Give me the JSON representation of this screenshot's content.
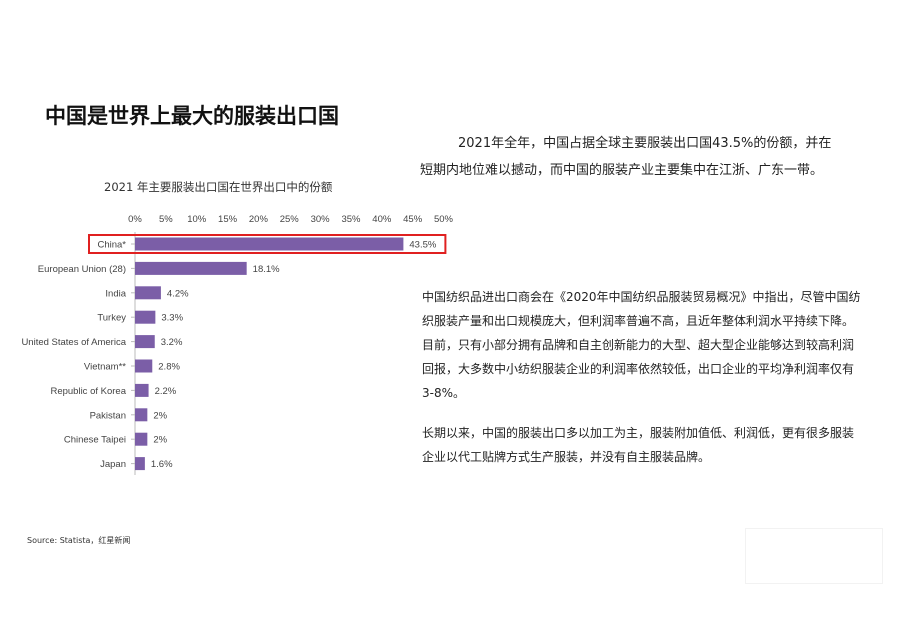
{
  "slide": {
    "title": "中国是世界上最大的服装出口国",
    "paragraph1": "2021年全年，中国占据全球主要服装出口国43.5%的份额，并在短期内地位难以撼动，而中国的服装产业主要集中在江浙、广东一带。",
    "paragraph2": "中国纺织品进出口商会在《2020年中国纺织品服装贸易概况》中指出，尽管中国纺织服装产量和出口规模庞大，但利润率普遍不高，且近年整体利润水平持续下降。目前，只有小部分拥有品牌和自主创新能力的大型、超大型企业能够达到较高利润回报，大多数中小纺织服装企业的利润率依然较低，出口企业的平均净利润率仅有3-8%。",
    "paragraph3": "长期以来，中国的服装出口多以加工为主，服装附加值低、利润低，更有很多服装企业以代工贴牌方式生产服装，并没有自主服装品牌。",
    "source": "Source: Statista，红星新闻"
  },
  "chart_data": {
    "type": "bar",
    "orientation": "horizontal",
    "title": "2021 年主要服装出口国在世界出口中的份额",
    "categories": [
      "China*",
      "European Union (28)",
      "India",
      "Turkey",
      "United States of America",
      "Vietnam**",
      "Republic of Korea",
      "Pakistan",
      "Chinese Taipei",
      "Japan"
    ],
    "values": [
      43.5,
      18.1,
      4.2,
      3.3,
      3.2,
      2.8,
      2.2,
      2,
      2,
      1.6
    ],
    "value_labels": [
      "43.5%",
      "18.1%",
      "4.2%",
      "3.3%",
      "3.2%",
      "2.8%",
      "2.2%",
      "2%",
      "2%",
      "1.6%"
    ],
    "x_ticks": [
      "0%",
      "5%",
      "10%",
      "15%",
      "20%",
      "25%",
      "30%",
      "35%",
      "40%",
      "45%",
      "50%"
    ],
    "xlim": [
      0,
      50
    ],
    "grid": false,
    "bar_color": "#7b5ea7",
    "highlight_category": "China*",
    "highlight_color": "#e02020"
  }
}
